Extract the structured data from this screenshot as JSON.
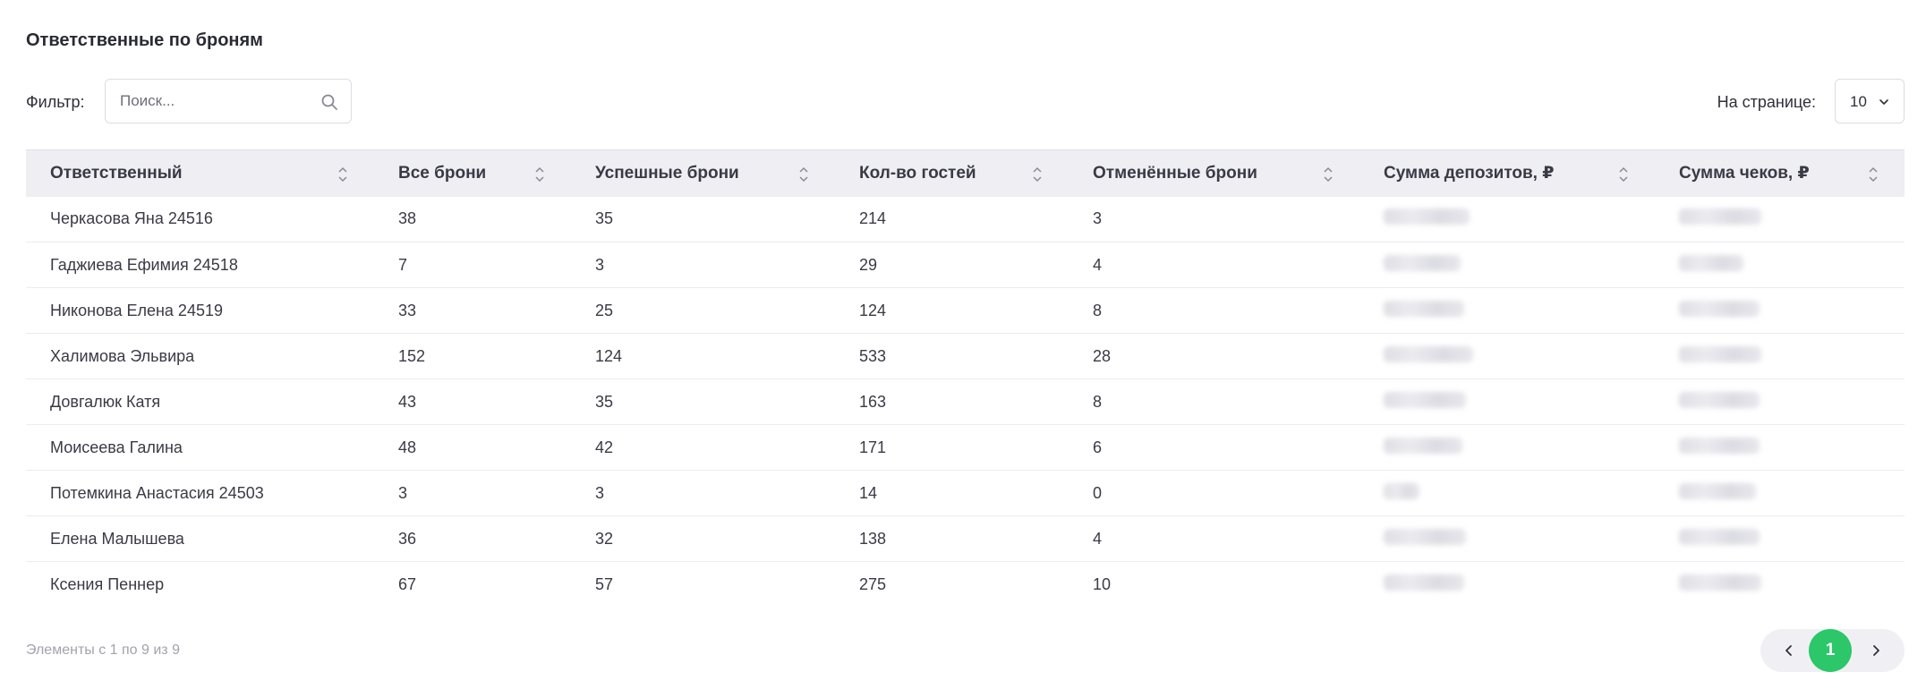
{
  "title": "Ответственные по броням",
  "filter": {
    "label": "Фильтр:",
    "search_placeholder": "Поиск...",
    "search_value": ""
  },
  "per_page": {
    "label": "На странице:",
    "value": "10"
  },
  "table": {
    "columns": [
      "Ответственный",
      "Все брони",
      "Успешные брони",
      "Кол-во гостей",
      "Отменённые брони",
      "Сумма депозитов, ₽",
      "Сумма чеков, ₽"
    ],
    "rows": [
      [
        "Черкасова Яна 24516",
        "38",
        "35",
        "214",
        "3"
      ],
      [
        "Гаджиева Ефимия 24518",
        "7",
        "3",
        "29",
        "4"
      ],
      [
        "Никонова Елена 24519",
        "33",
        "25",
        "124",
        "8"
      ],
      [
        "Халимова Эльвира",
        "152",
        "124",
        "533",
        "28"
      ],
      [
        "Довгалюк Катя",
        "43",
        "35",
        "163",
        "8"
      ],
      [
        "Моисеева Галина",
        "48",
        "42",
        "171",
        "6"
      ],
      [
        "Потемкина Анастасия 24503",
        "3",
        "3",
        "14",
        "0"
      ],
      [
        "Елена Малышева",
        "36",
        "32",
        "138",
        "4"
      ],
      [
        "Ксения Пеннер",
        "67",
        "57",
        "275",
        "10"
      ]
    ],
    "blurred_note": "deposit and check sums are redacted"
  },
  "footer": {
    "info": "Элементы с 1 по 9 из 9",
    "current_page": "1"
  },
  "colors": {
    "accent": "#2bc768",
    "header_bg": "#eeeef3"
  },
  "icons": {
    "search": "search-icon",
    "sort": "sort-icon",
    "chevron": "chevron-down-icon",
    "prev": "chevron-left-icon",
    "next": "chevron-right-icon"
  }
}
